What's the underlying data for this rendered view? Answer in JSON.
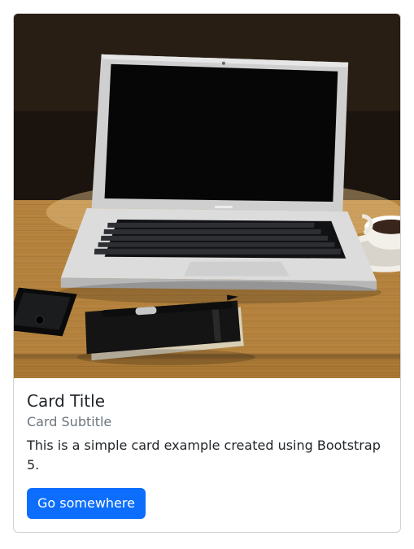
{
  "card": {
    "title": "Card Title",
    "subtitle": "Card Subtitle",
    "text": "This is a simple card example created using Bootstrap 5.",
    "button_label": "Go somewhere",
    "image_alt": "Laptop on wooden desk with notebook and coffee"
  }
}
